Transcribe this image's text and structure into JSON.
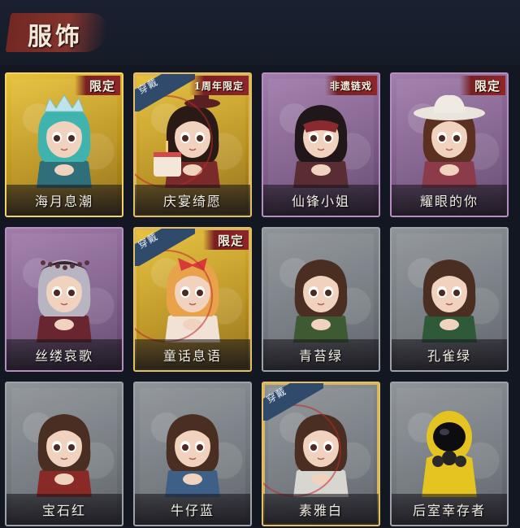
{
  "header": {
    "title": "服饰"
  },
  "worn_label": "穿戴",
  "colors": {
    "gold": "#e8c23a",
    "purple": "#7b5a86",
    "gray": "#6f757b",
    "badge": "#7a1f22"
  },
  "outfits": [
    {
      "name": "海月息潮",
      "badge": "限定",
      "frame": "gold",
      "equipped": false,
      "icon": "mermaid-crown-avatar-icon"
    },
    {
      "name": "庆宴绮愿",
      "badge": "1周年限定",
      "frame": "gold",
      "equipped": true,
      "icon": "birthday-cake-avatar-icon"
    },
    {
      "name": "仙锋小姐",
      "badge": "非遗链戏",
      "frame": "purple",
      "equipped": false,
      "icon": "masked-girl-avatar-icon"
    },
    {
      "name": "耀眼的你",
      "badge": "限定",
      "frame": "purple",
      "equipped": false,
      "icon": "cowboy-hat-avatar-icon"
    },
    {
      "name": "丝缕哀歌",
      "badge": "",
      "frame": "purple",
      "equipped": false,
      "icon": "lace-headdress-avatar-icon"
    },
    {
      "name": "童话息语",
      "badge": "限定",
      "frame": "gold",
      "equipped": true,
      "icon": "fairy-tale-girl-avatar-icon"
    },
    {
      "name": "青苔绿",
      "badge": "",
      "frame": "gray",
      "equipped": false,
      "icon": "green-jacket-girl-avatar-icon"
    },
    {
      "name": "孔雀绿",
      "badge": "",
      "frame": "gray",
      "equipped": false,
      "icon": "peacock-green-girl-avatar-icon"
    },
    {
      "name": "宝石红",
      "badge": "",
      "frame": "gray",
      "equipped": false,
      "icon": "red-jacket-girl-avatar-icon"
    },
    {
      "name": "牛仔蓝",
      "badge": "",
      "frame": "gray",
      "equipped": false,
      "icon": "denim-girl-avatar-icon"
    },
    {
      "name": "素雅白",
      "badge": "",
      "frame": "gray",
      "equipped": true,
      "icon": "white-outfit-girl-avatar-icon"
    },
    {
      "name": "后室幸存者",
      "badge": "",
      "frame": "gray",
      "equipped": false,
      "icon": "hazmat-gasmask-avatar-icon"
    }
  ]
}
